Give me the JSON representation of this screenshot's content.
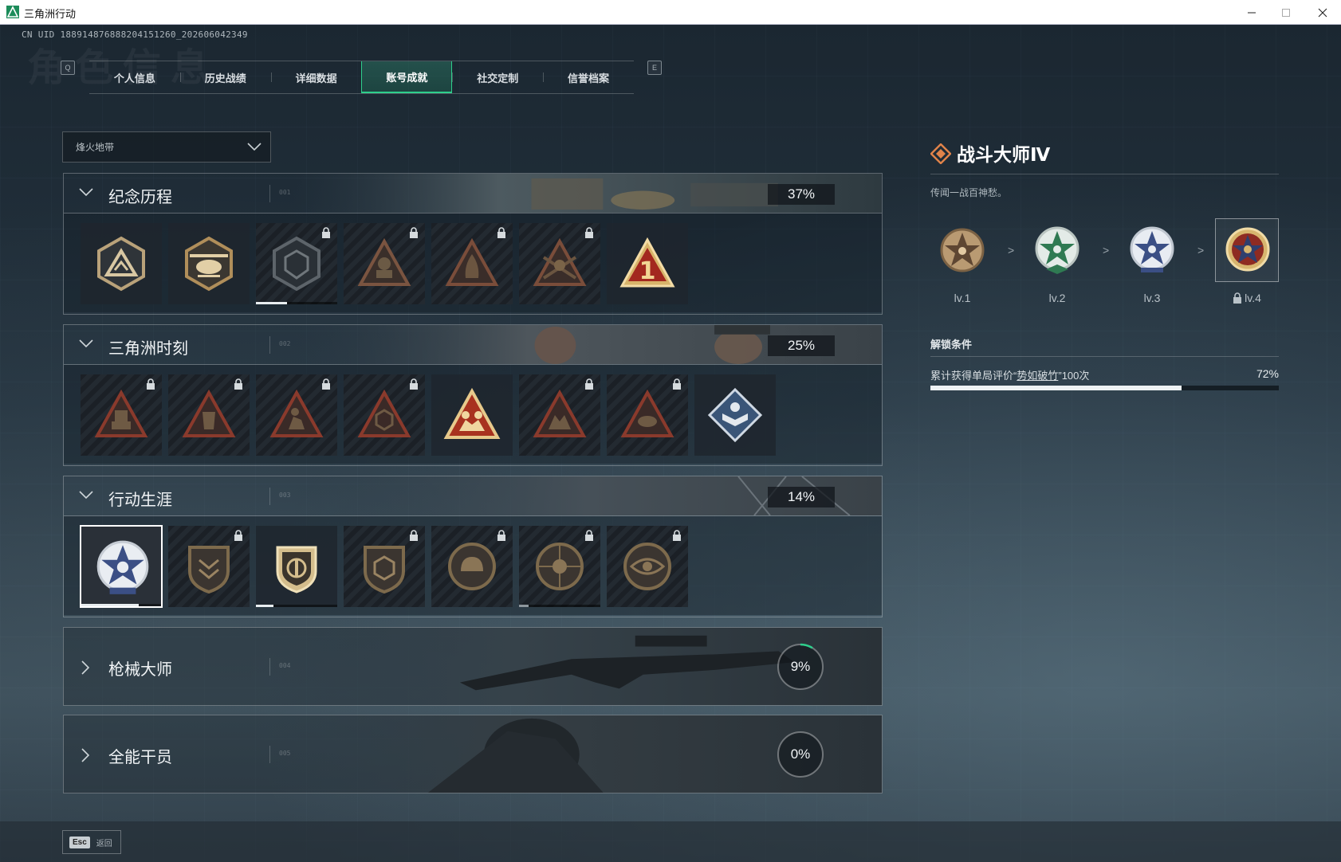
{
  "window": {
    "title": "三角洲行动"
  },
  "uid": "CN UID 1889148768882041512​60_202606042349",
  "bg_title": "角色信息",
  "tabs": {
    "prev_key": "Q",
    "next_key": "E",
    "items": [
      {
        "label": "个人信息",
        "active": false
      },
      {
        "label": "历史战绩",
        "active": false
      },
      {
        "label": "详细数据",
        "active": false
      },
      {
        "label": "账号成就",
        "active": true
      },
      {
        "label": "社交定制",
        "active": false
      },
      {
        "label": "信誉档案",
        "active": false
      }
    ]
  },
  "mode_select": {
    "value": "烽火地带"
  },
  "categories": [
    {
      "name": "纪念历程",
      "code": "001",
      "percent": "37%",
      "expanded": true
    },
    {
      "name": "三角洲时刻",
      "code": "002",
      "percent": "25%",
      "expanded": true
    },
    {
      "name": "行动生涯",
      "code": "003",
      "percent": "14%",
      "expanded": true
    },
    {
      "name": "枪械大师",
      "code": "004",
      "percent": "9%",
      "progress": 0.09,
      "expanded": false
    },
    {
      "name": "全能干员",
      "code": "005",
      "percent": "0%",
      "progress": 0.0,
      "expanded": false
    }
  ],
  "detail": {
    "title": "战斗大师Ⅳ",
    "description": "传闻一战百神愁。",
    "levels": [
      "lv.1",
      "lv.2",
      "lv.3",
      "lv.4"
    ],
    "separator": ">",
    "unlock_title": "解锁条件",
    "condition_prefix": "累计获得单局评价“",
    "condition_link": "势如破竹",
    "condition_suffix": "”100次",
    "condition_percent": "72%",
    "condition_progress": 0.72
  },
  "footer": {
    "esc_key": "Esc",
    "esc_label": "返回"
  },
  "colors": {
    "accent": "#2ecf8c",
    "gold": "#c7a26a",
    "rust": "#c0392b"
  }
}
